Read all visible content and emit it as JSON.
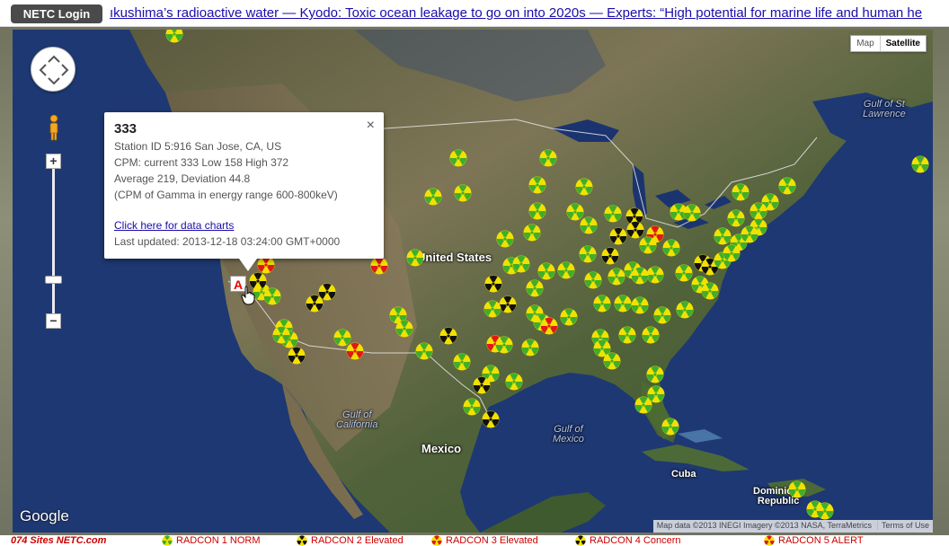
{
  "header": {
    "login_label": "NETC Login",
    "ticker_text": "ıkushima’s radioactive water — Kyodo: Toxic ocean leakage to go on into 2020s — Experts: “High potential for marine life and human he"
  },
  "map": {
    "maptype": {
      "map_label": "Map",
      "satellite_label": "Satellite",
      "active": "Satellite"
    },
    "labels": {
      "united_states": "United States",
      "mexico": "Mexico",
      "cuba": "Cuba",
      "dominican_republic_line1": "Dominican",
      "dominican_republic_line2": "Republic",
      "gulf_california_line1": "Gulf of",
      "gulf_california_line2": "California",
      "gulf_mexico_line1": "Gulf of",
      "gulf_mexico_line2": "Mexico",
      "gulf_st_lawrence_line1": "Gulf of St",
      "gulf_st_lawrence_line2": "Lawrence"
    },
    "google_logo": "Google",
    "attribution": "Map data ©2013 INEGI Imagery ©2013 NASA, TerraMetrics",
    "terms_label": "Terms of Use",
    "colors": {
      "ocean": "#1f3a78",
      "land": "#6e6a4c",
      "marker_green": "#3fae2a",
      "marker_yellow": "#f2e100",
      "marker_red": "#e01818",
      "marker_black": "#111111"
    }
  },
  "infowindow": {
    "title": "333",
    "station": "Station ID 5:916   San Jose, CA, US",
    "cpm": "CPM: current 333 Low 158 High 372",
    "average": "Average 219, Deviation 44.8",
    "range": "(CPM of Gamma in energy range 600-800keV)",
    "link": "Click here for data charts",
    "updated": "Last updated: 2013-12-18 03:24:00 GMT+0000",
    "close_glyph": "×"
  },
  "alert_marker_letter": "A",
  "legend": {
    "site": "074 Sites NETC.com",
    "items": [
      "RADCON 1 NORM",
      "RADCON 2 Elevated",
      "RADCON 3 Elevated",
      "RADCON 4 Concern",
      "RADCON 5 ALERT"
    ]
  }
}
